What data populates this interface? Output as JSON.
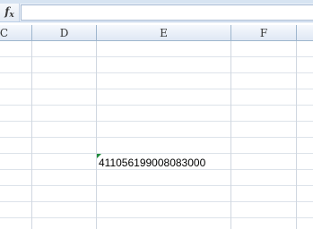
{
  "formula_bar": {
    "fx_label": "f",
    "fx_sub": "x",
    "value": ""
  },
  "columns": [
    {
      "label": "C"
    },
    {
      "label": "D"
    },
    {
      "label": "E"
    },
    {
      "label": "F"
    }
  ],
  "cell_e": {
    "value": "411056199008083000",
    "indicator_color": "#1f8a3a"
  },
  "colors": {
    "header_border": "#9eb6ce",
    "gridline": "#dde3ea"
  }
}
